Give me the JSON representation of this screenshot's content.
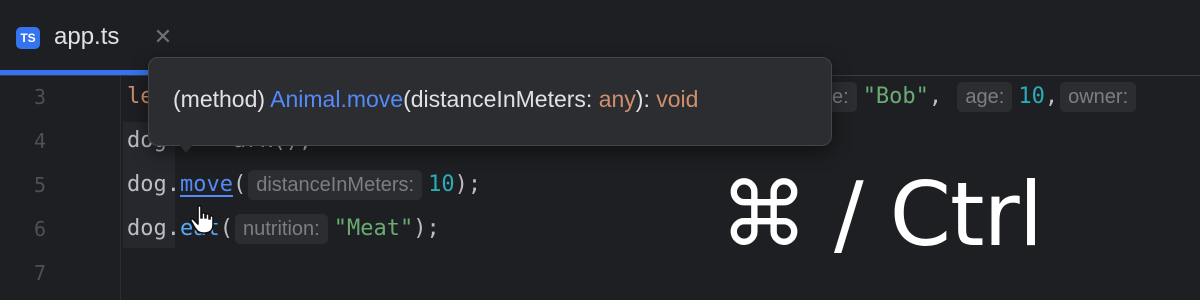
{
  "tab": {
    "badge": "TS",
    "title": "app.ts",
    "close_glyph": "✕"
  },
  "gutter": {
    "line_numbers": [
      "3",
      "4",
      "5",
      "6",
      "7"
    ]
  },
  "editor": {
    "line3": {
      "keyword_fragment": "le",
      "hint_name_tail": "e:",
      "name_value": "\"Bob\"",
      "sep1": ", ",
      "hint_age": "age:",
      "age_value": "10",
      "sep2": ",",
      "hint_owner": "owner:"
    },
    "line4": {
      "object": "dog",
      "rest": "ark();"
    },
    "line5": {
      "object": "dog",
      "dot": ".",
      "method": "move",
      "open": "(",
      "hint": "distanceInMeters:",
      "arg": "10",
      "close": ");"
    },
    "line6": {
      "object": "dog",
      "dot": ".",
      "method_fragment": "eat",
      "open": "(",
      "hint": "nutrition:",
      "arg": "\"Meat\"",
      "close": ");"
    }
  },
  "popup": {
    "prefix": "(method) ",
    "signature": "Animal.move",
    "open_paren": "(",
    "param": "distanceInMeters: ",
    "param_type": "any",
    "close_paren": "): ",
    "return_type": "void"
  },
  "overlay": {
    "shortcut": "⌘ / Ctrl"
  },
  "icons": {
    "cursor": "hand-pointer-icon",
    "close": "close-icon"
  },
  "colors": {
    "accent": "#3574f0",
    "keyword": "#cf8e6d",
    "string": "#6aab73",
    "number": "#2aacb8",
    "link": "#548af7"
  }
}
